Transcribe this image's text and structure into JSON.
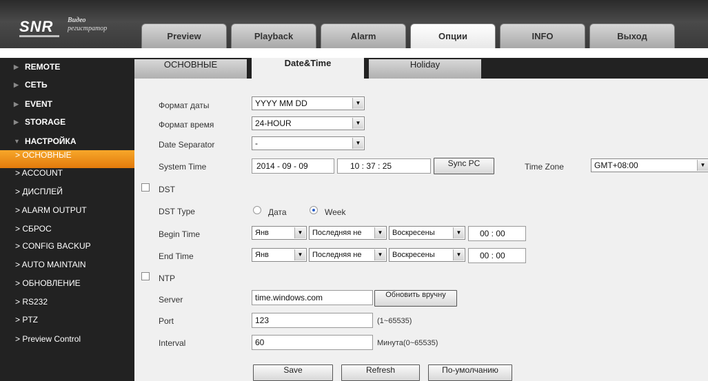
{
  "brand": {
    "logo": "SNR",
    "tag1": "Видео",
    "tag2": "регистратор"
  },
  "top_tabs": [
    "Preview",
    "Playback",
    "Alarm",
    "Опции",
    "INFO",
    "Выход"
  ],
  "active_top_tab": "Опции",
  "sidebar": {
    "groups": [
      "REMOTE",
      "СЕТЬ",
      "EVENT",
      "STORAGE",
      "НАСТРОЙКА"
    ],
    "items": [
      "> ОСНОВНЫЕ",
      "> ACCOUNT",
      "> ДИСПЛЕЙ",
      "> ALARM OUTPUT",
      "> СБРОС",
      "> CONFIG BACKUP",
      "> AUTO MAINTAIN",
      "> ОБНОВЛЕНИЕ",
      "> RS232",
      "> PTZ",
      "> Preview Control"
    ],
    "selected": "> ОСНОВНЫЕ"
  },
  "content_tabs": [
    "ОСНОВНЫЕ",
    "Date&Time",
    "Holiday"
  ],
  "active_content_tab": "Date&Time",
  "form": {
    "date_format_label": "Формат даты",
    "date_format_value": "YYYY MM DD",
    "time_format_label": "Формат время",
    "time_format_value": "24-HOUR",
    "separator_label": "Date Separator",
    "separator_value": "-",
    "system_time_label": "System Time",
    "date_value": "2014 - 09 - 09",
    "time_value": "10 : 37 : 25",
    "sync_pc": "Sync PC",
    "timezone_label": "Time Zone",
    "timezone_value": "GMT+08:00",
    "dst_label": "DST",
    "dst_type_label": "DST Type",
    "dst_date": "Дата",
    "dst_week": "Week",
    "begin_label": "Begin Time",
    "end_label": "End Time",
    "month": "Янв",
    "week": "Последняя не",
    "day": "Воскресены",
    "begin_hm": "00 : 00",
    "end_hm": "00 : 00",
    "ntp_label": "NTP",
    "server_label": "Server",
    "server_value": "time.windows.com",
    "update_btn": "Обновить вручну",
    "port_label": "Port",
    "port_value": "123",
    "port_hint": "(1~65535)",
    "interval_label": "Interval",
    "interval_value": "60",
    "interval_hint": "Минута(0~65535)",
    "save": "Save",
    "refresh": "Refresh",
    "default": "По-умолчанию"
  }
}
